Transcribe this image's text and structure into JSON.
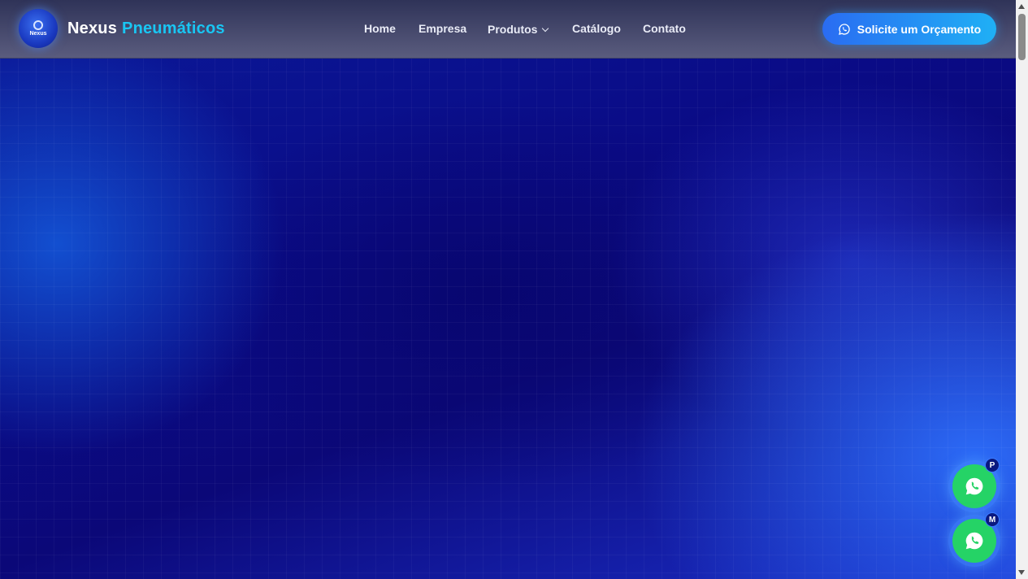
{
  "brand": {
    "name_primary": "Nexus",
    "name_accent": "Pneumáticos",
    "logo_text": "Nexus"
  },
  "nav": {
    "items": [
      {
        "label": "Home"
      },
      {
        "label": "Empresa"
      },
      {
        "label": "Produtos"
      },
      {
        "label": "Catálogo"
      },
      {
        "label": "Contato"
      }
    ]
  },
  "cta": {
    "label": "Solicite um Orçamento",
    "icon": "whatsapp-icon"
  },
  "floating": [
    {
      "badge": "P",
      "icon": "whatsapp-icon"
    },
    {
      "badge": "M",
      "icon": "whatsapp-icon"
    }
  ],
  "colors": {
    "accent": "#19c6f3",
    "cta_start": "#2a6cf2",
    "cta_end": "#1fb0f5",
    "whatsapp": "#25d366",
    "hero": "#0a0a7a"
  }
}
